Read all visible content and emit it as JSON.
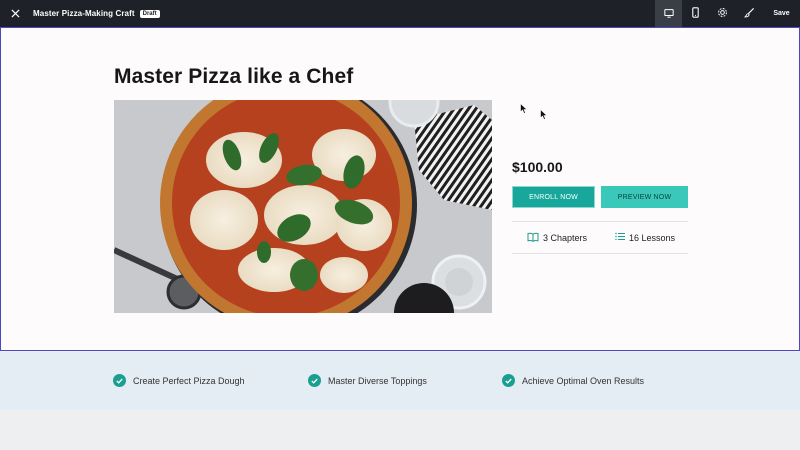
{
  "topbar": {
    "title": "Master Pizza-Making Craft",
    "badge": "Draft",
    "save_label": "Save",
    "icons": [
      "close-icon",
      "desktop-icon",
      "mobile-icon",
      "settings-icon",
      "brush-icon"
    ]
  },
  "course": {
    "title": "Master Pizza like a Chef",
    "image_alt": "pizza photo",
    "price": "$100.00",
    "enroll_label": "ENROLL NOW",
    "preview_label": "PREVIEW NOW",
    "chapters": "3 Chapters",
    "lessons": "16 Lessons"
  },
  "outcomes": [
    "Create Perfect Pizza Dough",
    "Master Diverse Toppings",
    "Achieve Optimal Oven Results"
  ],
  "colors": {
    "topbar": "#1e2128",
    "accent": "#17a89b",
    "accent_light": "#39c8ba",
    "canvas_border": "#4b49c8",
    "band": "#e4ecf4"
  }
}
